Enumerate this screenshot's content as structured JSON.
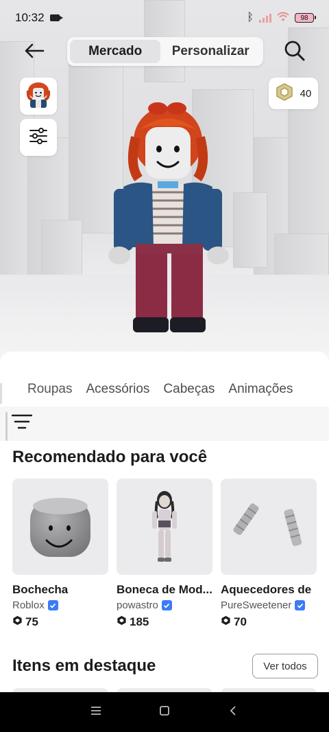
{
  "status_bar": {
    "time": "10:32",
    "battery": "98"
  },
  "top_nav": {
    "tabs": [
      {
        "label": "Mercado",
        "active": true
      },
      {
        "label": "Personalizar",
        "active": false
      }
    ],
    "back_icon": "arrow-left-icon",
    "search_icon": "search-icon"
  },
  "robux": {
    "amount": "40",
    "icon": "robux-icon"
  },
  "categories": [
    "Roupas",
    "Acessórios",
    "Cabeças",
    "Animações"
  ],
  "recommended": {
    "title": "Recomendado para você",
    "items": [
      {
        "name": "Bochecha",
        "creator": "Roblox",
        "price": "75"
      },
      {
        "name": "Boneca de Mod...",
        "creator": "powastro",
        "price": "185"
      },
      {
        "name": "Aquecedores de",
        "creator": "PureSweetener",
        "price": "70"
      }
    ]
  },
  "featured": {
    "title": "Itens em destaque",
    "see_all_label": "Ver todos"
  },
  "colors": {
    "verified": "#3b7cf6",
    "accent_text": "#1c1c1c"
  }
}
